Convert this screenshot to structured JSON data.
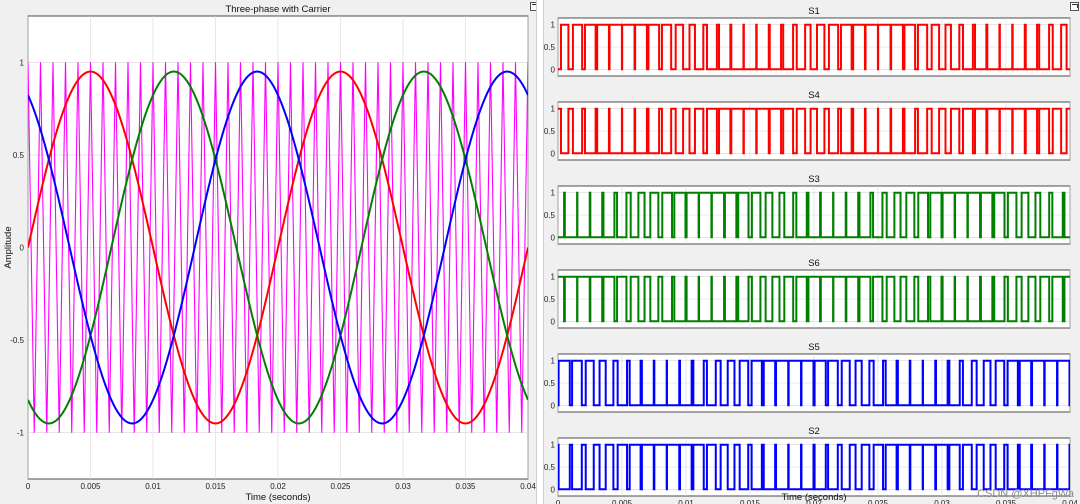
{
  "colors": {
    "phase_a": "#ff0000",
    "phase_b": "#008000",
    "phase_c": "#0000ff",
    "carrier": "#ff00ff",
    "grid": "#d8d8d8"
  },
  "watermark": "CSDN @XHPFgWa",
  "chart_data": [
    {
      "type": "line",
      "title": "Three-phase with Carrier",
      "xlabel": "Time (seconds)",
      "ylabel": "Amplitude",
      "xlim": [
        0,
        0.04
      ],
      "ylim": [
        -1.25,
        1.25
      ],
      "xticks": [
        0,
        0.005,
        0.01,
        0.015,
        0.02,
        0.025,
        0.03,
        0.035,
        0.04
      ],
      "xtick_labels": [
        "0",
        "0.005",
        "0.01",
        "0.015",
        "0.02",
        "0.025",
        "0.03",
        "0.035",
        "0.04"
      ],
      "yticks": [
        -1,
        -0.5,
        0,
        0.5,
        1
      ],
      "ytick_labels": [
        "-1",
        "-0.5",
        "0",
        "0.5",
        "1"
      ],
      "grid": true,
      "series": [
        {
          "key": "a",
          "color": "#ff0000",
          "amplitude": 0.95,
          "frequency_hz": 50,
          "phase_deg": 0
        },
        {
          "key": "b",
          "color": "#008000",
          "amplitude": 0.95,
          "frequency_hz": 50,
          "phase_deg": -120
        },
        {
          "key": "c",
          "color": "#0000ff",
          "amplitude": 0.95,
          "frequency_hz": 50,
          "phase_deg": 120
        },
        {
          "key": "carrier",
          "color": "#ff00ff",
          "type": "triangle",
          "amplitude": 1,
          "frequency_hz": 1000
        }
      ]
    },
    {
      "type": "line",
      "subplots": [
        {
          "title": "S1",
          "color": "#ff0000",
          "source": "a",
          "invert": false
        },
        {
          "title": "S4",
          "color": "#ff0000",
          "source": "a",
          "invert": true
        },
        {
          "title": "S3",
          "color": "#008000",
          "source": "b",
          "invert": false
        },
        {
          "title": "S6",
          "color": "#008000",
          "source": "b",
          "invert": true
        },
        {
          "title": "S5",
          "color": "#0000ff",
          "source": "c",
          "invert": false
        },
        {
          "title": "S2",
          "color": "#0000ff",
          "source": "c",
          "invert": true
        }
      ],
      "xlabel": "Time (seconds)",
      "xlim": [
        0,
        0.04
      ],
      "ylim": [
        -0.15,
        1.15
      ],
      "yticks": [
        0,
        0.5,
        1
      ],
      "ytick_labels": [
        "0",
        "0.5",
        "1"
      ],
      "xticks": [
        0,
        0.005,
        0.01,
        0.015,
        0.02,
        0.025,
        0.03,
        0.035,
        0.04
      ],
      "xtick_labels": [
        "0",
        "0.005",
        "0.01",
        "0.015",
        "0.02",
        "0.025",
        "0.03",
        "0.035",
        "0.04"
      ],
      "grid": true
    }
  ]
}
